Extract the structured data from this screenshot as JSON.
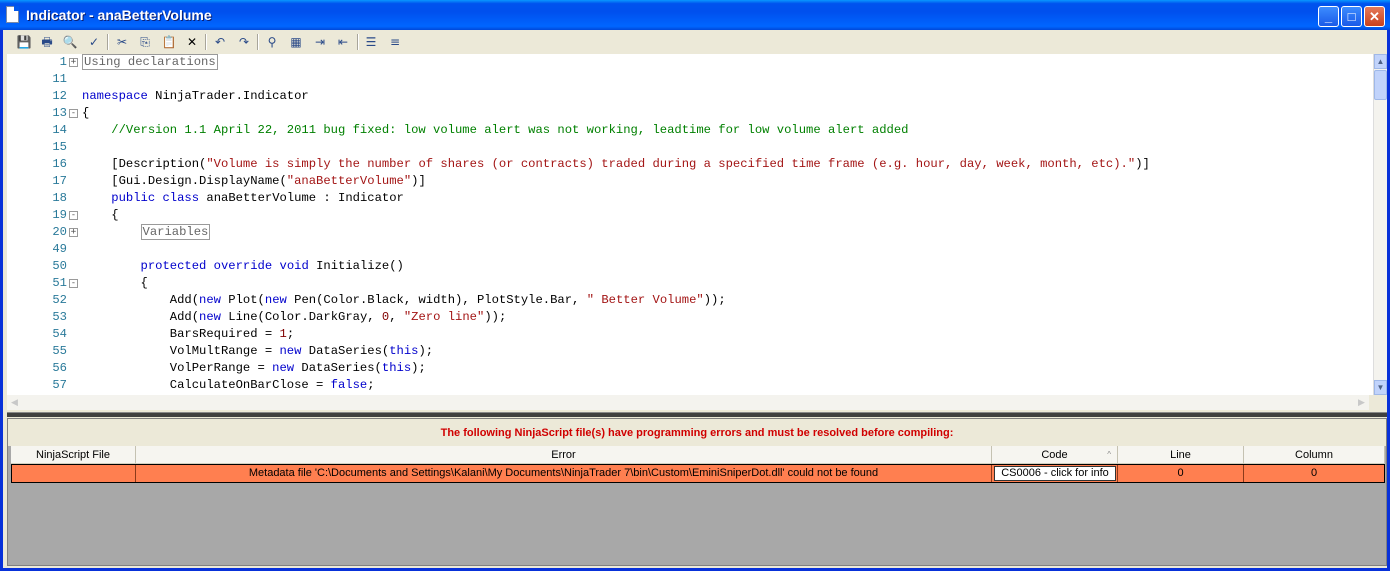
{
  "window": {
    "title": "Indicator - anaBetterVolume"
  },
  "toolbar": {
    "icons": [
      "save-icon",
      "print-icon",
      "print-preview-icon",
      "check-icon",
      "cut-icon",
      "copy-icon",
      "paste-icon",
      "delete-icon",
      "undo-icon",
      "redo-icon",
      "find-icon",
      "replace-icon",
      "indent-icon",
      "outdent-icon",
      "comment-icon",
      "uncomment-icon"
    ]
  },
  "editor": {
    "lines": [
      {
        "num": "1",
        "fold": "+",
        "segs": [
          {
            "t": "Using declarations",
            "c": "collapsed"
          }
        ]
      },
      {
        "num": "11",
        "segs": []
      },
      {
        "num": "12",
        "segs": [
          {
            "t": "namespace",
            "c": "kw"
          },
          {
            "t": " NinjaTrader.Indicator"
          }
        ]
      },
      {
        "num": "13",
        "fold": "-",
        "segs": [
          {
            "t": "{"
          }
        ]
      },
      {
        "num": "14",
        "segs": [
          {
            "t": "    //Version 1.1 April 22, 2011 bug fixed: low volume alert was not working, leadtime for low volume alert added",
            "c": "cm"
          }
        ]
      },
      {
        "num": "15",
        "segs": []
      },
      {
        "num": "16",
        "segs": [
          {
            "t": "    [Description("
          },
          {
            "t": "\"Volume is simply the number of shares (or contracts) traded during a specified time frame (e.g. hour, day, week, month, etc).\"",
            "c": "str"
          },
          {
            "t": ")]"
          }
        ]
      },
      {
        "num": "17",
        "segs": [
          {
            "t": "    [Gui.Design.DisplayName("
          },
          {
            "t": "\"anaBetterVolume\"",
            "c": "str"
          },
          {
            "t": ")]"
          }
        ]
      },
      {
        "num": "18",
        "segs": [
          {
            "t": "    "
          },
          {
            "t": "public",
            "c": "kw"
          },
          {
            "t": " "
          },
          {
            "t": "class",
            "c": "kw"
          },
          {
            "t": " anaBetterVolume : Indicator"
          }
        ]
      },
      {
        "num": "19",
        "fold": "-",
        "segs": [
          {
            "t": "    {"
          }
        ]
      },
      {
        "num": "20",
        "fold": "+",
        "segs": [
          {
            "t": "        "
          },
          {
            "t": "Variables",
            "c": "collapsed"
          }
        ]
      },
      {
        "num": "49",
        "segs": []
      },
      {
        "num": "50",
        "segs": [
          {
            "t": "        "
          },
          {
            "t": "protected",
            "c": "kw"
          },
          {
            "t": " "
          },
          {
            "t": "override",
            "c": "kw"
          },
          {
            "t": " "
          },
          {
            "t": "void",
            "c": "kw"
          },
          {
            "t": " Initialize()"
          }
        ]
      },
      {
        "num": "51",
        "fold": "-",
        "segs": [
          {
            "t": "        {"
          }
        ]
      },
      {
        "num": "52",
        "segs": [
          {
            "t": "            Add("
          },
          {
            "t": "new",
            "c": "kw"
          },
          {
            "t": " Plot("
          },
          {
            "t": "new",
            "c": "kw"
          },
          {
            "t": " Pen(Color.Black, width), PlotStyle.Bar, "
          },
          {
            "t": "\" Better Volume\"",
            "c": "str"
          },
          {
            "t": "));"
          }
        ]
      },
      {
        "num": "53",
        "segs": [
          {
            "t": "            Add("
          },
          {
            "t": "new",
            "c": "kw"
          },
          {
            "t": " Line(Color.DarkGray, "
          },
          {
            "t": "0",
            "c": "num"
          },
          {
            "t": ", "
          },
          {
            "t": "\"Zero line\"",
            "c": "str"
          },
          {
            "t": "));"
          }
        ]
      },
      {
        "num": "54",
        "segs": [
          {
            "t": "            BarsRequired = "
          },
          {
            "t": "1",
            "c": "num"
          },
          {
            "t": ";"
          }
        ]
      },
      {
        "num": "55",
        "segs": [
          {
            "t": "            VolMultRange = "
          },
          {
            "t": "new",
            "c": "kw"
          },
          {
            "t": " DataSeries("
          },
          {
            "t": "this",
            "c": "kw"
          },
          {
            "t": ");"
          }
        ]
      },
      {
        "num": "56",
        "segs": [
          {
            "t": "            VolPerRange = "
          },
          {
            "t": "new",
            "c": "kw"
          },
          {
            "t": " DataSeries("
          },
          {
            "t": "this",
            "c": "kw"
          },
          {
            "t": ");"
          }
        ]
      },
      {
        "num": "57",
        "segs": [
          {
            "t": "            CalculateOnBarClose = "
          },
          {
            "t": "false",
            "c": "kw"
          },
          {
            "t": ";"
          }
        ]
      }
    ]
  },
  "errors": {
    "message": "The following NinjaScript file(s) have programming errors and must be resolved before compiling:",
    "columns": [
      "NinjaScript File",
      "Error",
      "Code",
      "Line",
      "Column"
    ],
    "rows": [
      {
        "file": "",
        "error": "Metadata file 'C:\\Documents and Settings\\Kalani\\My Documents\\NinjaTrader 7\\bin\\Custom\\EminiSniperDot.dll' could not be found",
        "code": "CS0006 - click for info",
        "line": "0",
        "column": "0"
      }
    ],
    "row_color": "#ff7f50"
  }
}
